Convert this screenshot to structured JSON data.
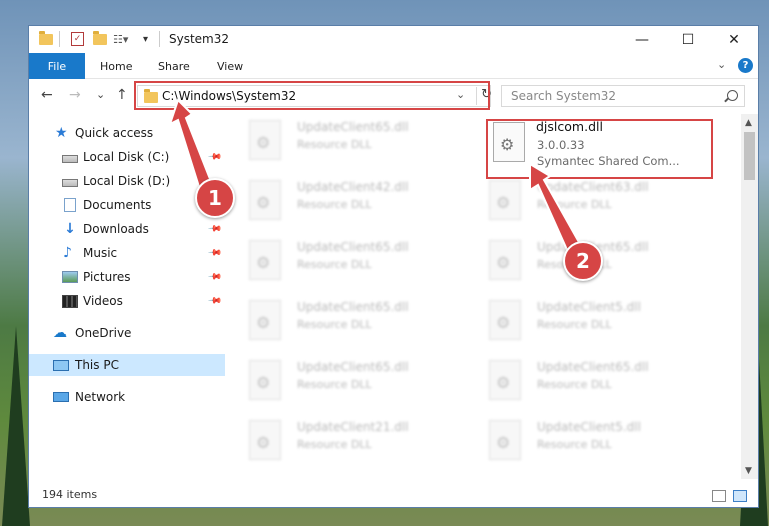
{
  "window": {
    "title": "System32",
    "controls": {
      "minimize": "—",
      "maximize": "☐",
      "close": "✕"
    }
  },
  "ribbon": {
    "tabs": [
      "File",
      "Home",
      "Share",
      "View"
    ],
    "help": "?"
  },
  "navigation": {
    "back": "←",
    "forward": "→",
    "recent": "⌄",
    "up": "↑",
    "address": "C:\\Windows\\System32",
    "search_placeholder": "Search System32"
  },
  "sidebar": {
    "items": [
      {
        "label": "Quick access",
        "icon": "star-icon"
      },
      {
        "label": "Local Disk (C:)",
        "icon": "disk-icon",
        "pinned": true
      },
      {
        "label": "Local Disk (D:)",
        "icon": "disk-icon",
        "pinned": false
      },
      {
        "label": "Documents",
        "icon": "documents-icon",
        "pinned": true
      },
      {
        "label": "Downloads",
        "icon": "downloads-icon",
        "pinned": true
      },
      {
        "label": "Music",
        "icon": "music-icon",
        "pinned": true
      },
      {
        "label": "Pictures",
        "icon": "pictures-icon",
        "pinned": true
      },
      {
        "label": "Videos",
        "icon": "videos-icon",
        "pinned": true
      },
      {
        "label": "OneDrive",
        "icon": "cloud-icon"
      },
      {
        "label": "This PC",
        "icon": "pc-icon",
        "selected": true
      },
      {
        "label": "Network",
        "icon": "network-icon"
      }
    ]
  },
  "files": {
    "highlighted": {
      "name": "djslcom.dll",
      "version": "3.0.0.33",
      "company": "Symantec Shared Com..."
    },
    "blurred": [
      {
        "name": "UpdateClient65.dll",
        "type": "Resource DLL"
      },
      {
        "name": "UpdateClient42.dll",
        "type": "Resource DLL"
      },
      {
        "name": "UpdateClient63.dll",
        "type": "Resource DLL"
      },
      {
        "name": "UpdateClient65.dll",
        "type": "Resource DLL"
      },
      {
        "name": "UpdateClient65.dll",
        "type": "Resource DLL"
      },
      {
        "name": "UpdateClient65.dll",
        "type": "Resource DLL"
      },
      {
        "name": "UpdateClient5.dll",
        "type": "Resource DLL"
      },
      {
        "name": "UpdateClient65.dll",
        "type": "Resource DLL"
      },
      {
        "name": "UpdateClient65.dll",
        "type": "Resource DLL"
      },
      {
        "name": "UpdateClient21.dll",
        "type": "Resource DLL"
      },
      {
        "name": "UpdateClient5.dll",
        "type": "Resource DLL"
      }
    ]
  },
  "status": {
    "item_count": "194 items"
  },
  "callouts": {
    "one": "1",
    "two": "2"
  },
  "colors": {
    "accent": "#1979ca",
    "callout": "#d64545",
    "selection": "#cce8ff"
  }
}
